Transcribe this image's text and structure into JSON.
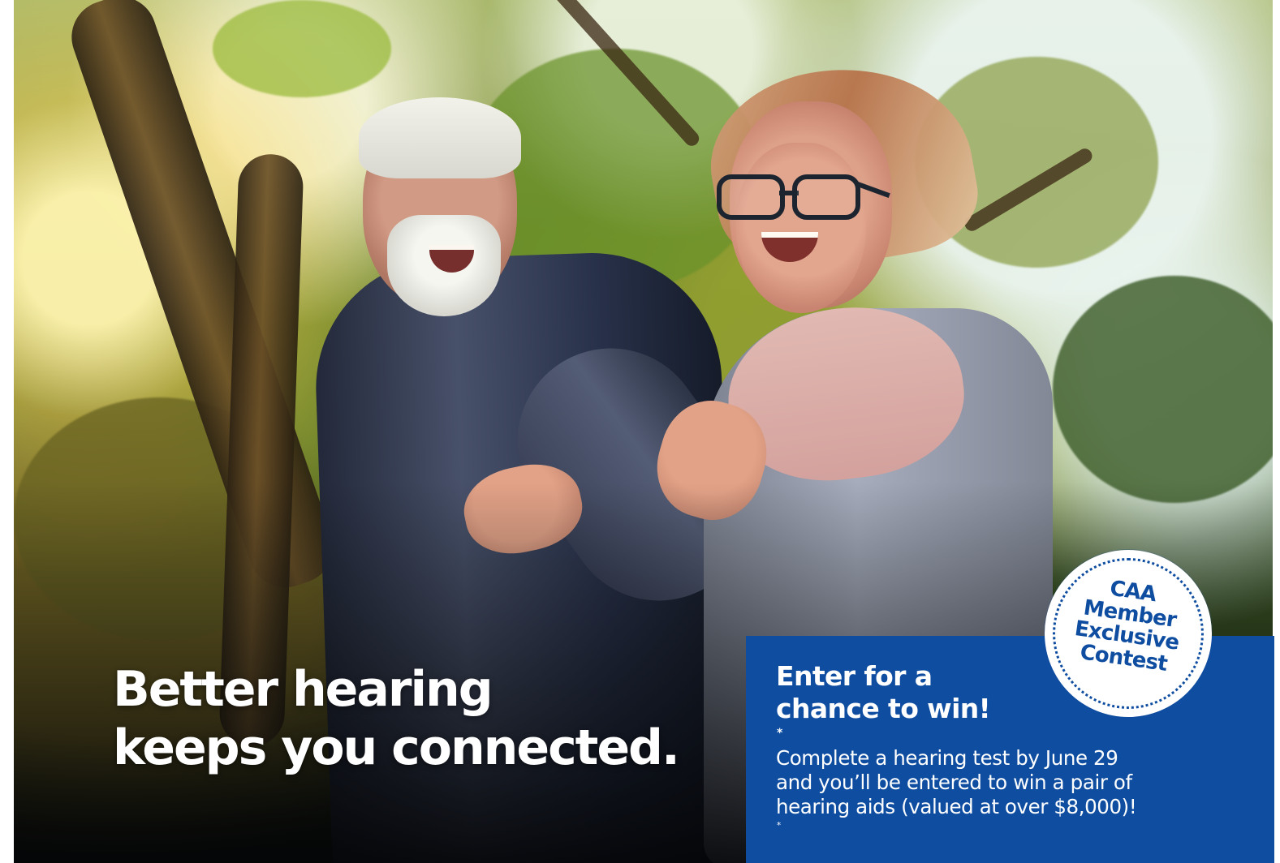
{
  "photo": {
    "description_icon": "couple-jogging-photo"
  },
  "headline": {
    "line_1": "Better hearing",
    "line_2": "keeps you connected."
  },
  "contest": {
    "title_line_1": "Enter for a",
    "title_line_2": "chance to win!",
    "title_marker": "*",
    "copy_line_1": "Complete a hearing test by June 29",
    "copy_line_2": "and you’ll be entered to win a pair of",
    "copy_line_3": "hearing aids (valued at over $8,000)!",
    "copy_marker": "*"
  },
  "badge": {
    "line_1": "CAA",
    "line_2": "Member",
    "line_3": "Exclusive",
    "line_4": "Contest"
  },
  "colors": {
    "brand_blue": "#0f4da1",
    "white": "#ffffff"
  }
}
